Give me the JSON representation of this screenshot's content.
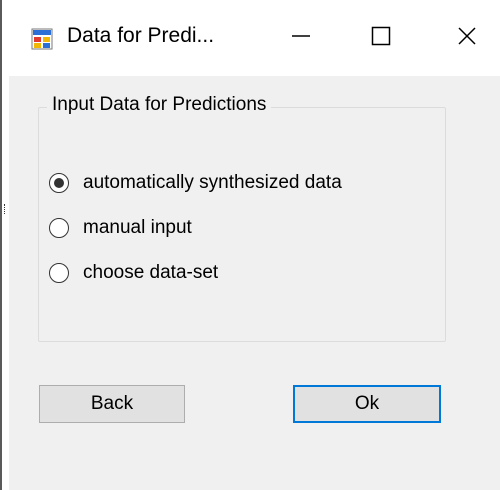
{
  "window": {
    "title": "Data for Predi...",
    "icon": "app-window-icon",
    "controls": {
      "minimize_icon": "minimize-icon",
      "maximize_icon": "maximize-icon",
      "close_icon": "close-icon"
    }
  },
  "groupbox": {
    "label": "Input Data for Predictions",
    "options": [
      {
        "label": "automatically synthesized data",
        "selected": true
      },
      {
        "label": "manual input",
        "selected": false
      },
      {
        "label": "choose data-set",
        "selected": false
      }
    ]
  },
  "buttons": {
    "back_label": "Back",
    "ok_label": "Ok"
  },
  "colors": {
    "window_bg": "#f0f0f0",
    "titlebar_bg": "#ffffff",
    "button_bg": "#e1e1e1",
    "button_border": "#adadad",
    "focus_accent": "#0078d7"
  }
}
